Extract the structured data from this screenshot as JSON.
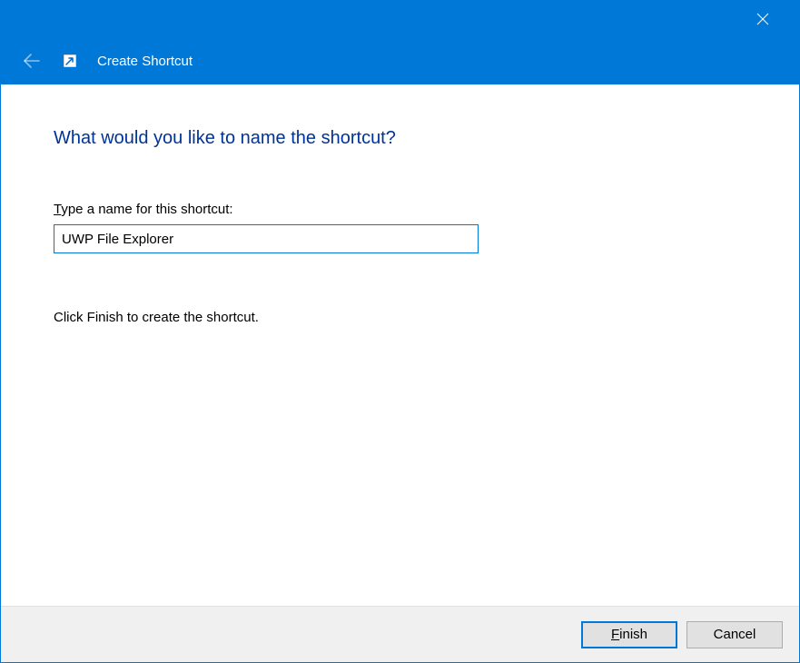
{
  "window": {
    "title": "Create Shortcut"
  },
  "heading": "What would you like to name the shortcut?",
  "field": {
    "label_prefix": "T",
    "label_rest": "ype a name for this shortcut:",
    "value": "UWP File Explorer"
  },
  "instruction": "Click Finish to create the shortcut.",
  "buttons": {
    "finish_prefix": "F",
    "finish_rest": "inish",
    "cancel": "Cancel"
  }
}
